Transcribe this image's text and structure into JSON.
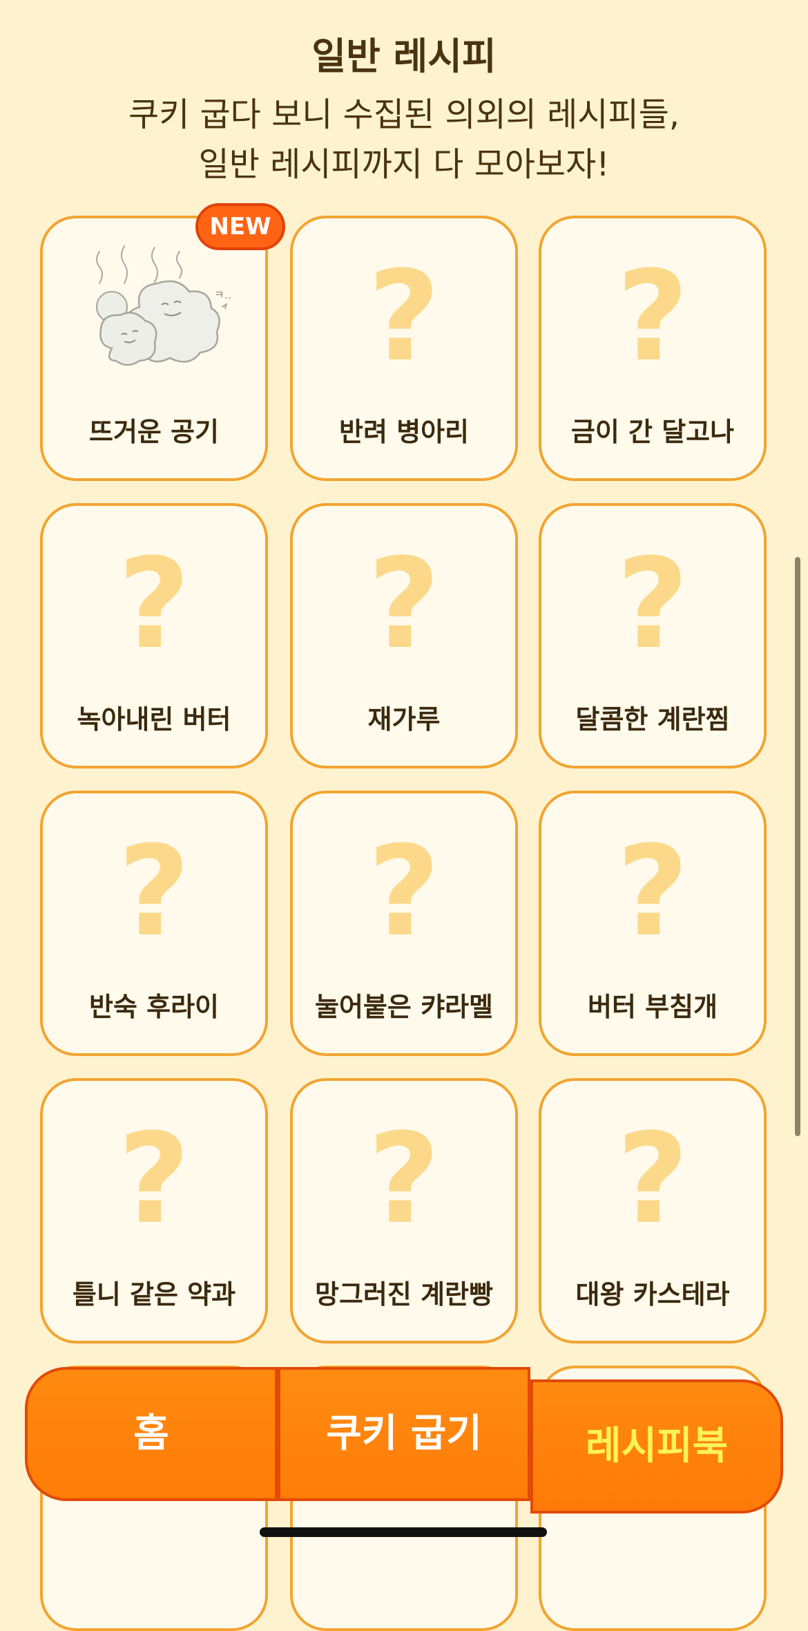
{
  "header": {
    "title": "일반 레시피",
    "subtitle_line1": "쿠키 굽다 보니 수집된 의외의 레시피들,",
    "subtitle_line2": "일반 레시피까지 다 모아보자!"
  },
  "recipes": [
    {
      "name": "뜨거운 공기",
      "unlocked": true,
      "new_badge": "NEW"
    },
    {
      "name": "반려 병아리",
      "unlocked": false
    },
    {
      "name": "금이 간 달고나",
      "unlocked": false
    },
    {
      "name": "녹아내린 버터",
      "unlocked": false
    },
    {
      "name": "재가루",
      "unlocked": false
    },
    {
      "name": "달콤한 계란찜",
      "unlocked": false
    },
    {
      "name": "반숙 후라이",
      "unlocked": false
    },
    {
      "name": "눌어붙은 캬라멜",
      "unlocked": false
    },
    {
      "name": "버터 부침개",
      "unlocked": false
    },
    {
      "name": "틀니 같은 약과",
      "unlocked": false
    },
    {
      "name": "망그러진 계란빵",
      "unlocked": false
    },
    {
      "name": "대왕 카스테라",
      "unlocked": false
    }
  ],
  "locked_symbol": "?",
  "tabs": {
    "home": "홈",
    "bake": "쿠키 굽기",
    "recipe": "레시피북",
    "active": "recipe"
  },
  "colors": {
    "background": "#fff3cf",
    "card_border": "#f2a431",
    "question_mark": "#fcd98a",
    "tab_orange": "#ff7c08",
    "active_tab_text": "#fff35a",
    "badge": "#ff6414"
  }
}
